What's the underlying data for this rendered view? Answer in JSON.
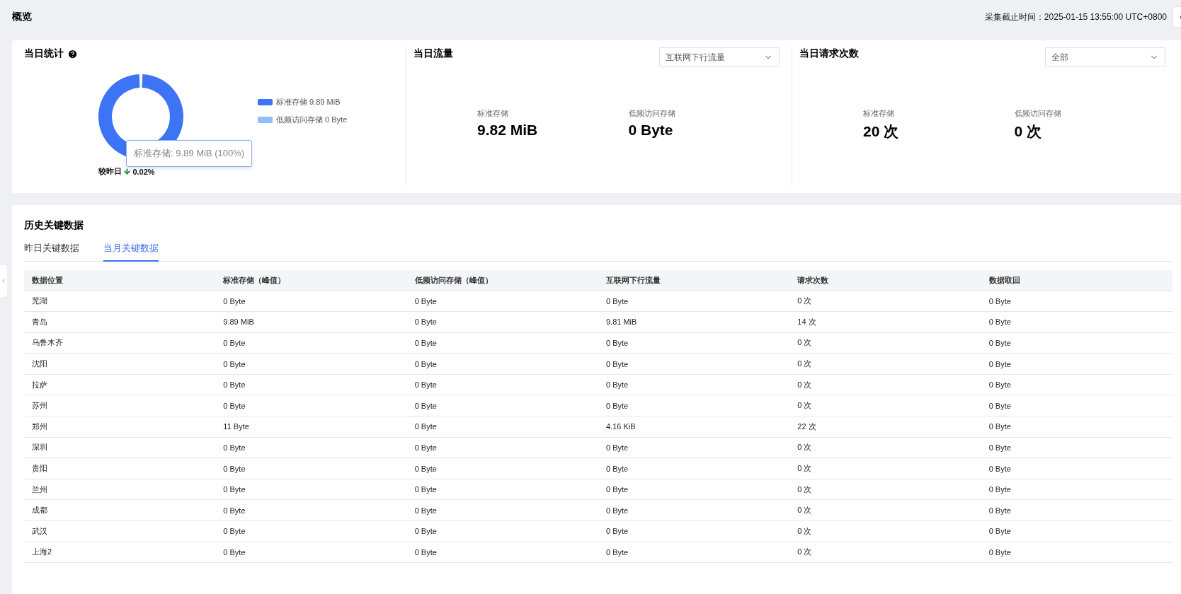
{
  "page_title": "概览",
  "collected_at": "采集截止时间：2025-01-15 13:55:00 UTC+0800",
  "daily_stats": {
    "title": "当日统计",
    "legend": [
      {
        "label": "标准存储 9.89 MiB",
        "color": "#3d74f6"
      },
      {
        "label": "低频访问存储 0 Byte",
        "color": "#92bbfc"
      }
    ],
    "tooltip": "标准存储: 9.89 MiB (100%)",
    "compare": {
      "label": "较昨日",
      "decreased": true,
      "change": "0.02%"
    }
  },
  "daily_traffic": {
    "title": "当日流量",
    "dropdown": "互联网下行流量",
    "metrics": [
      {
        "label": "标准存储",
        "value": "9.82 MiB"
      },
      {
        "label": "低频访问存储",
        "value": "0 Byte"
      }
    ]
  },
  "daily_requests": {
    "title": "当日请求次数",
    "dropdown": "全部",
    "metrics": [
      {
        "label": "标准存储",
        "value": "20 次"
      },
      {
        "label": "低频访问存储",
        "value": "0 次"
      }
    ]
  },
  "history": {
    "title": "历史关键数据",
    "tabs": [
      {
        "label": "昨日关键数据",
        "selected": false
      },
      {
        "label": "当月关键数据",
        "selected": true
      }
    ],
    "table": {
      "columns": [
        "数据位置",
        "标准存储（峰值）",
        "低频访问存储（峰值）",
        "互联网下行流量",
        "请求次数",
        "数据取回"
      ],
      "rows": [
        [
          "芜湖",
          "0 Byte",
          "0 Byte",
          "0 Byte",
          "0 次",
          "0 Byte"
        ],
        [
          "青岛",
          "9.89 MiB",
          "0 Byte",
          "9.81 MiB",
          "14 次",
          "0 Byte"
        ],
        [
          "乌鲁木齐",
          "0 Byte",
          "0 Byte",
          "0 Byte",
          "0 次",
          "0 Byte"
        ],
        [
          "沈阳",
          "0 Byte",
          "0 Byte",
          "0 Byte",
          "0 次",
          "0 Byte"
        ],
        [
          "拉萨",
          "0 Byte",
          "0 Byte",
          "0 Byte",
          "0 次",
          "0 Byte"
        ],
        [
          "苏州",
          "0 Byte",
          "0 Byte",
          "0 Byte",
          "0 次",
          "0 Byte"
        ],
        [
          "郑州",
          "11 Byte",
          "0 Byte",
          "4.16 KiB",
          "22 次",
          "0 Byte"
        ],
        [
          "深圳",
          "0 Byte",
          "0 Byte",
          "0 Byte",
          "0 次",
          "0 Byte"
        ],
        [
          "贵阳",
          "0 Byte",
          "0 Byte",
          "0 Byte",
          "0 次",
          "0 Byte"
        ],
        [
          "兰州",
          "0 Byte",
          "0 Byte",
          "0 Byte",
          "0 次",
          "0 Byte"
        ],
        [
          "成都",
          "0 Byte",
          "0 Byte",
          "0 Byte",
          "0 次",
          "0 Byte"
        ],
        [
          "武汉",
          "0 Byte",
          "0 Byte",
          "0 Byte",
          "0 次",
          "0 Byte"
        ],
        [
          "上海2",
          "0 Byte",
          "0 Byte",
          "0 Byte",
          "0 次",
          "0 Byte"
        ]
      ]
    }
  }
}
